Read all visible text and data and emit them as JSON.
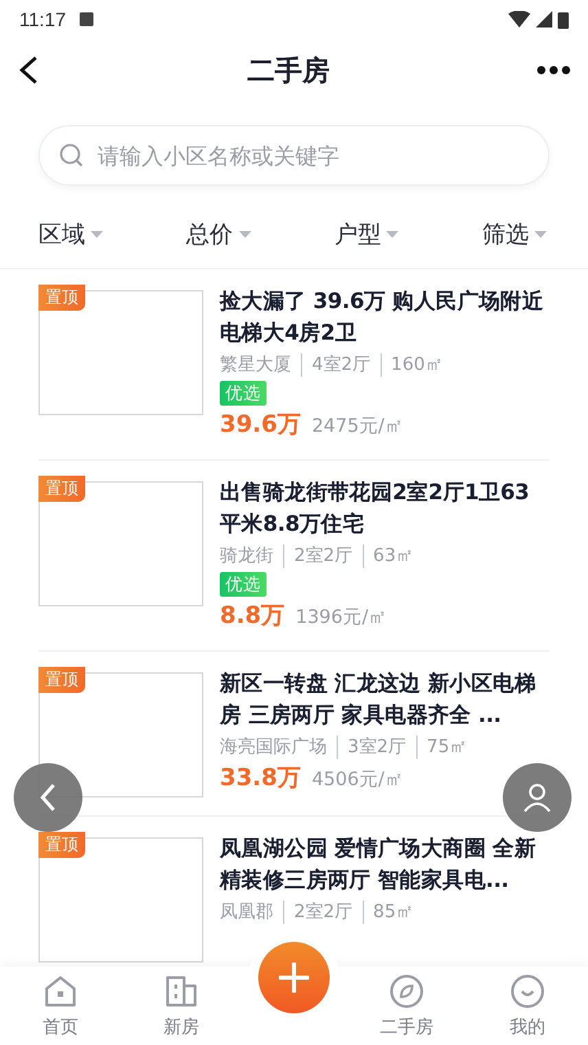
{
  "status_bar": {
    "time": "11:17"
  },
  "header": {
    "title": "二手房"
  },
  "search": {
    "placeholder": "请输入小区名称或关键字"
  },
  "filters": [
    {
      "label": "区域"
    },
    {
      "label": "总价"
    },
    {
      "label": "户型"
    },
    {
      "label": "筛选"
    }
  ],
  "listings": [
    {
      "tag": "置顶",
      "title": "捡大漏了 39.6万 购人民广场附近电梯大4房2卫",
      "meta": [
        "繁星大厦",
        "4室2厅",
        "160㎡"
      ],
      "badge": "优选",
      "price": "39.6万",
      "unit_price": "2475元/㎡"
    },
    {
      "tag": "置顶",
      "title": "出售骑龙街带花园2室2厅1卫63平米8.8万住宅",
      "meta": [
        "骑龙街",
        "2室2厅",
        "63㎡"
      ],
      "badge": "优选",
      "price": "8.8万",
      "unit_price": "1396元/㎡"
    },
    {
      "tag": "置顶",
      "title": "新区一转盘 汇龙这边 新小区电梯房 三房两厅 家具电器齐全 ...",
      "meta": [
        "海亮国际广场",
        "3室2厅",
        "75㎡"
      ],
      "price": "33.8万",
      "unit_price": "4506元/㎡"
    },
    {
      "tag": "置顶",
      "title": "凤凰湖公园 爱情广场大商圈 全新精装修三房两厅 智能家具电...",
      "meta": [
        "凤凰郡",
        "2室2厅",
        "85㎡"
      ]
    }
  ],
  "tab_bar": [
    {
      "kind": "tab",
      "label": "首页",
      "selected": false
    },
    {
      "kind": "tab",
      "label": "新房",
      "selected": false
    },
    {
      "kind": "action"
    },
    {
      "kind": "tab",
      "label": "二手房",
      "selected": false
    },
    {
      "kind": "tab",
      "label": "我的",
      "selected": false
    }
  ]
}
